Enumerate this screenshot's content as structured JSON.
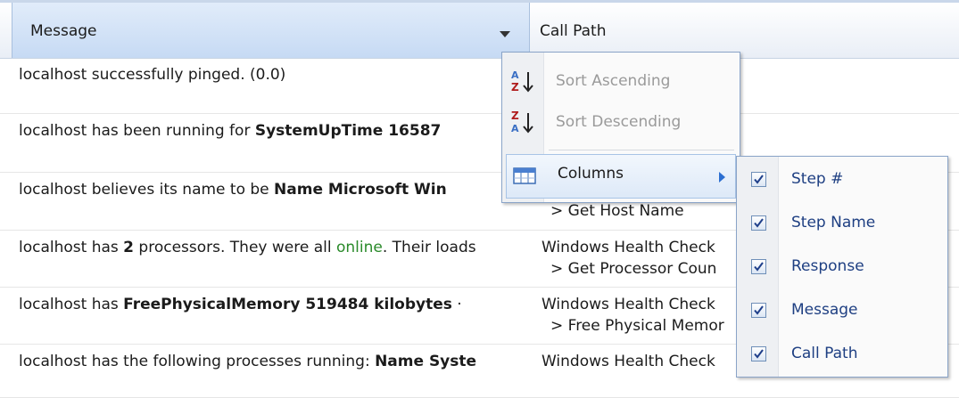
{
  "columns": {
    "message": "Message",
    "call_path": "Call Path"
  },
  "rows": [
    {
      "parts": [
        {
          "text": "localhost successfully pinged. (0.0)",
          "style": "normal"
        }
      ],
      "call_path_line1": "",
      "call_path_line2": ""
    },
    {
      "parts": [
        {
          "text": "localhost has been running for ",
          "style": "normal"
        },
        {
          "text": "SystemUpTime 16587",
          "style": "bold"
        }
      ],
      "call_path_line1": "",
      "call_path_line2": ""
    },
    {
      "parts": [
        {
          "text": "localhost believes its name to be ",
          "style": "normal"
        },
        {
          "text": "Name Microsoft Win",
          "style": "bold"
        }
      ],
      "call_path_line1": "",
      "call_path_line2": "> Get Host Name"
    },
    {
      "parts": [
        {
          "text": "localhost has ",
          "style": "normal"
        },
        {
          "text": "2",
          "style": "bold"
        },
        {
          "text": " processors. They were all ",
          "style": "normal"
        },
        {
          "text": "online",
          "style": "green"
        },
        {
          "text": ". Their loads",
          "style": "normal"
        }
      ],
      "call_path_line1": "Windows Health Check",
      "call_path_line2": "> Get Processor Coun"
    },
    {
      "parts": [
        {
          "text": "localhost has ",
          "style": "normal"
        },
        {
          "text": "FreePhysicalMemory 519484 kilobytes",
          "style": "bold"
        },
        {
          "text": " ·",
          "style": "normal"
        }
      ],
      "call_path_line1": "Windows Health Check",
      "call_path_line2": "> Free Physical Memor"
    },
    {
      "parts": [
        {
          "text": "localhost has the following processes running: ",
          "style": "normal"
        },
        {
          "text": "Name Syste",
          "style": "bold"
        }
      ],
      "call_path_line1": "Windows Health Check",
      "call_path_line2": ""
    }
  ],
  "menu": {
    "sort_ascending": "Sort Ascending",
    "sort_descending": "Sort Descending",
    "columns": "Columns",
    "icons": {
      "sort_ascending": "sort-az-icon",
      "sort_descending": "sort-za-icon",
      "columns": "columns-icon"
    }
  },
  "submenu": {
    "items": [
      {
        "label": "Step #",
        "checked": true
      },
      {
        "label": "Step Name",
        "checked": true
      },
      {
        "label": "Response",
        "checked": true
      },
      {
        "label": "Message",
        "checked": true
      },
      {
        "label": "Call Path",
        "checked": true
      }
    ]
  },
  "colors": {
    "header_selected": "#c6daf4",
    "menu_border": "#8aa4c8",
    "online_text": "#2a8a2a",
    "submenu_text": "#1e3f82"
  }
}
